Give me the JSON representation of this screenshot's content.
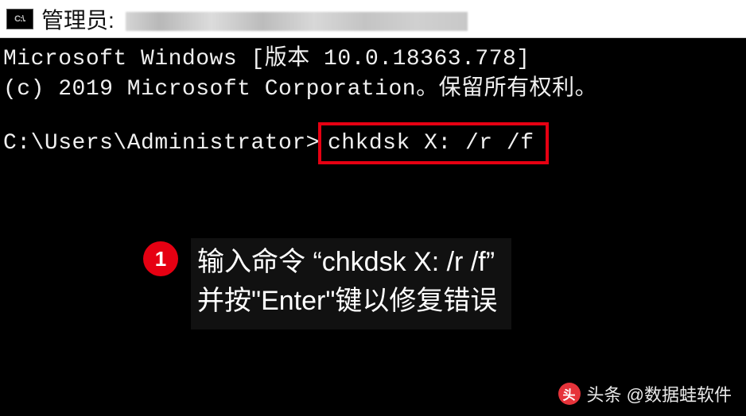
{
  "title_bar": {
    "icon_text": "C:\\.",
    "prefix": "管理员:"
  },
  "terminal": {
    "line1": "Microsoft Windows [版本 10.0.18363.778]",
    "line2": "(c) 2019 Microsoft Corporation。保留所有权利。",
    "prompt": "C:\\Users\\Administrator>",
    "command": "chkdsk X: /r /f"
  },
  "instruction": {
    "step_number": "1",
    "line1": "输入命令 “chkdsk X: /r /f”",
    "line2": "并按\"Enter\"键以修复错误"
  },
  "watermark": {
    "icon_glyph": "头",
    "text": "头条 @数据蛙软件"
  }
}
